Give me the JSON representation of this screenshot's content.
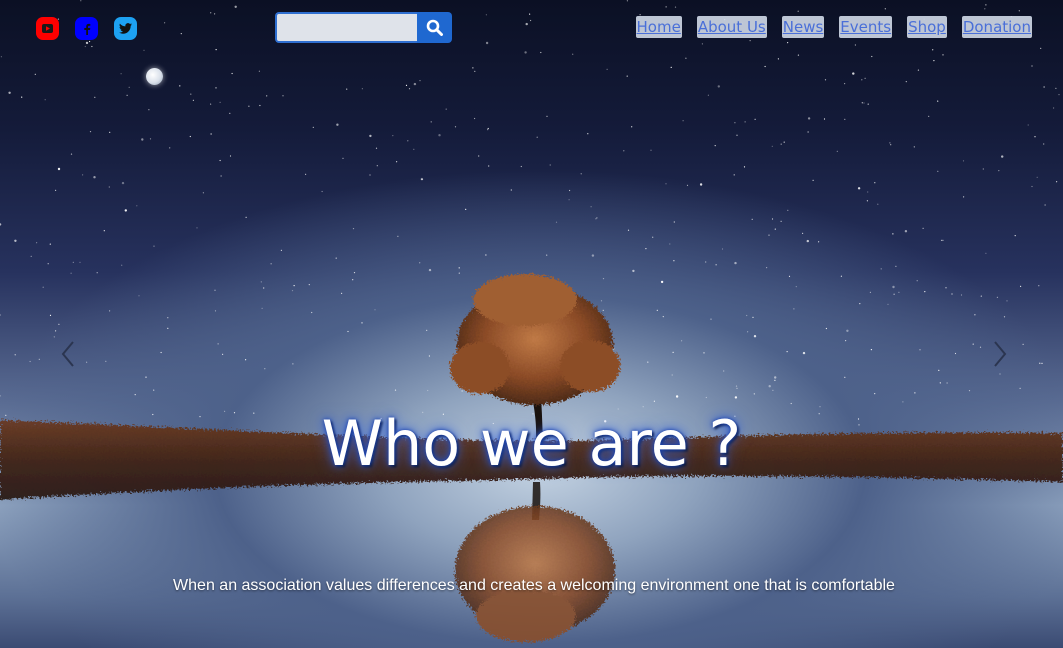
{
  "social": {
    "youtube_color": "#ff0000",
    "facebook_color": "#0000ff",
    "twitter_color": "#1da1f2"
  },
  "search": {
    "placeholder": "",
    "button_icon": "search-icon",
    "button_color": "#1f68d0"
  },
  "nav": {
    "items": [
      {
        "label": "Home"
      },
      {
        "label": "About Us"
      },
      {
        "label": "News"
      },
      {
        "label": "Events"
      },
      {
        "label": "Shop"
      },
      {
        "label": "Donation"
      }
    ],
    "link_color": "#4a6fd8"
  },
  "carousel": {
    "prev_icon": "chevron-left-icon",
    "next_icon": "chevron-right-icon"
  },
  "hero": {
    "headline": "Who we are ?",
    "subtitle": "When an association values differences and creates a welcoming environment one that is comfortable"
  }
}
